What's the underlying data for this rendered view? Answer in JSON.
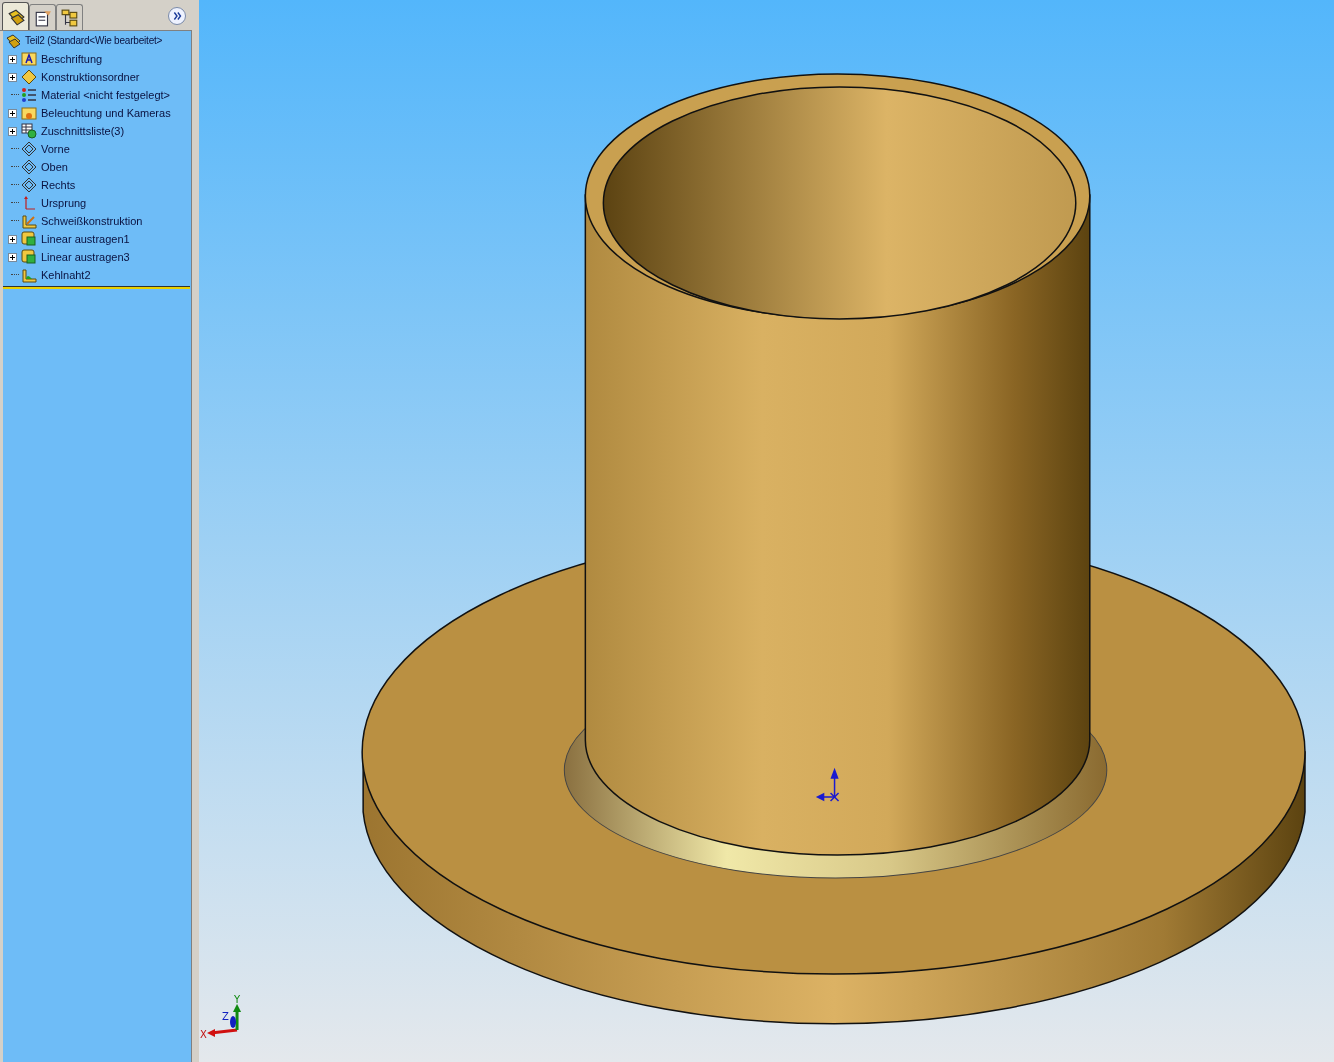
{
  "panel_tabs": [
    {
      "kind": "feature",
      "selected": true
    },
    {
      "kind": "property",
      "selected": false
    },
    {
      "kind": "config",
      "selected": false
    }
  ],
  "tree": {
    "root": {
      "label": "Teil2  (Standard<Wie bearbeitet>",
      "kind": "part"
    },
    "items": [
      {
        "label": "Beschriftung",
        "kind": "annotation",
        "expandable": true
      },
      {
        "label": "Konstruktionsordner",
        "kind": "folder",
        "expandable": true
      },
      {
        "label": "Material <nicht festgelegt>",
        "kind": "material",
        "expandable": false
      },
      {
        "label": "Beleuchtung und Kameras",
        "kind": "lights",
        "expandable": true
      },
      {
        "label": "Zuschnittsliste(3)",
        "kind": "cutlist",
        "expandable": true
      },
      {
        "label": "Vorne",
        "kind": "plane",
        "expandable": false
      },
      {
        "label": "Oben",
        "kind": "plane",
        "expandable": false
      },
      {
        "label": "Rechts",
        "kind": "plane",
        "expandable": false
      },
      {
        "label": "Ursprung",
        "kind": "origin",
        "expandable": false
      },
      {
        "label": "Schweißkonstruktion",
        "kind": "weldment",
        "expandable": false
      },
      {
        "label": "Linear austragen1",
        "kind": "extrude",
        "expandable": true
      },
      {
        "label": "Linear austragen3",
        "kind": "extrude",
        "expandable": true
      },
      {
        "label": "Kehlnaht2",
        "kind": "fillet",
        "expandable": false
      }
    ]
  },
  "view_triad": {
    "x": "X",
    "y": "Y",
    "z": "Z"
  }
}
